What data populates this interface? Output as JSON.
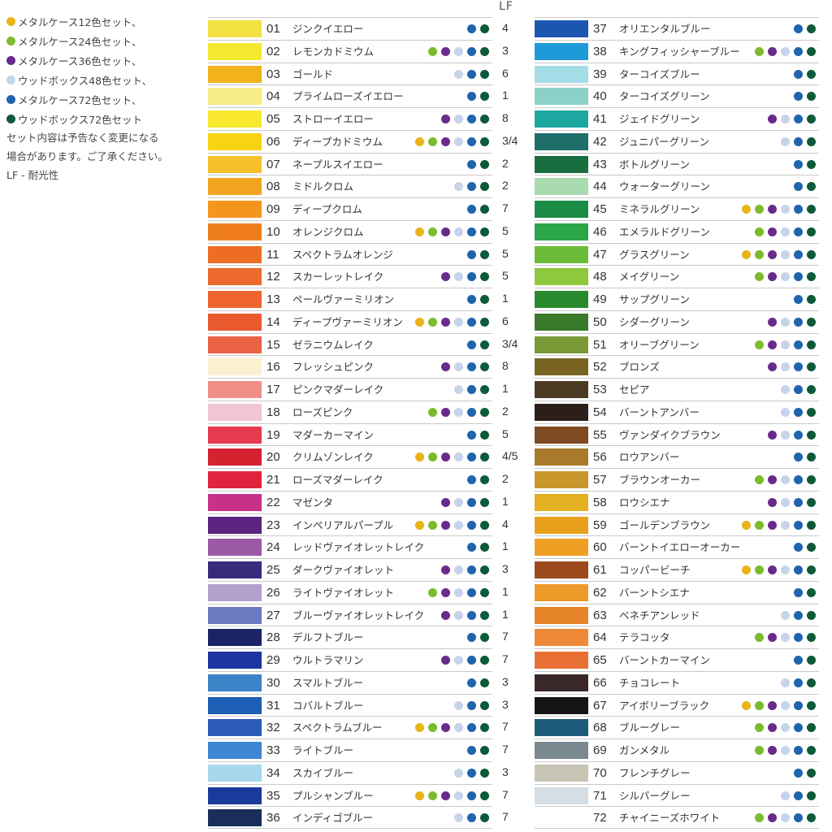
{
  "colors": {
    "s12": "#e8b418",
    "s24": "#7cbb2e",
    "s36": "#6a2a8a",
    "w48": "#c6d4ea",
    "s72": "#1f64ad",
    "w72": "#0d5a3a"
  },
  "legend": {
    "sets": [
      {
        "key": "s12",
        "label": "メタルケース12色セット、"
      },
      {
        "key": "s24",
        "label": "メタルケース24色セット、"
      },
      {
        "key": "s36",
        "label": "メタルケース36色セット、"
      },
      {
        "key": "w48",
        "label": "ウッドボックス48色セット、"
      },
      {
        "key": "s72",
        "label": "メタルケース72色セット、"
      },
      {
        "key": "w72",
        "label": "ウッドボックス72色セット"
      }
    ],
    "note_line1": "セット内容は予告なく変更になる",
    "note_line2": "場合があります。ご了承ください。",
    "lf_note": "LF - 耐光性"
  },
  "lf_header": "LF",
  "columns": [
    [
      {
        "num": "01",
        "name": "ジンクイエロー",
        "lf": "4",
        "sets": [
          "s72",
          "w72"
        ],
        "color": "#f3e142"
      },
      {
        "num": "02",
        "name": "レモンカドミウム",
        "lf": "3",
        "sets": [
          "s24",
          "s36",
          "w48",
          "s72",
          "w72"
        ],
        "color": "#f6e830"
      },
      {
        "num": "03",
        "name": "ゴールド",
        "lf": "6",
        "sets": [
          "w48",
          "s72",
          "w72"
        ],
        "color": "#f2b21c"
      },
      {
        "num": "04",
        "name": "プライムローズイエロー",
        "lf": "1",
        "sets": [
          "s72",
          "w72"
        ],
        "color": "#f7ec86"
      },
      {
        "num": "05",
        "name": "ストローイエロー",
        "lf": "8",
        "sets": [
          "s36",
          "w48",
          "s72",
          "w72"
        ],
        "color": "#f8e82e"
      },
      {
        "num": "06",
        "name": "ディープカドミウム",
        "lf": "3/4",
        "sets": [
          "s12",
          "s24",
          "s36",
          "w48",
          "s72",
          "w72"
        ],
        "color": "#f6d414"
      },
      {
        "num": "07",
        "name": "ネープルスイエロー",
        "lf": "2",
        "sets": [
          "s72",
          "w72"
        ],
        "color": "#f5c02a"
      },
      {
        "num": "08",
        "name": "ミドルクロム",
        "lf": "2",
        "sets": [
          "w48",
          "s72",
          "w72"
        ],
        "color": "#f2a420"
      },
      {
        "num": "09",
        "name": "ディープクロム",
        "lf": "7",
        "sets": [
          "s72",
          "w72"
        ],
        "color": "#f4961c"
      },
      {
        "num": "10",
        "name": "オレンジクロム",
        "lf": "5",
        "sets": [
          "s12",
          "s24",
          "s36",
          "w48",
          "s72",
          "w72"
        ],
        "color": "#ef7f1e"
      },
      {
        "num": "11",
        "name": "スペクトラムオレンジ",
        "lf": "5",
        "sets": [
          "s72",
          "w72"
        ],
        "color": "#ee6d24"
      },
      {
        "num": "12",
        "name": "スカーレットレイク",
        "lf": "5",
        "sets": [
          "s36",
          "w48",
          "s72",
          "w72"
        ],
        "color": "#ec6a2c"
      },
      {
        "num": "13",
        "name": "ペールヴァーミリオン",
        "lf": "1",
        "sets": [
          "s72",
          "w72"
        ],
        "color": "#ee6430"
      },
      {
        "num": "14",
        "name": "ディープヴァーミリオン",
        "lf": "6",
        "sets": [
          "s12",
          "s24",
          "s36",
          "w48",
          "s72",
          "w72"
        ],
        "color": "#e95a2e"
      },
      {
        "num": "15",
        "name": "ゼラニウムレイク",
        "lf": "3/4",
        "sets": [
          "s72",
          "w72"
        ],
        "color": "#ea6244"
      },
      {
        "num": "16",
        "name": "フレッシュピンク",
        "lf": "8",
        "sets": [
          "s36",
          "w48",
          "s72",
          "w72"
        ],
        "color": "#fbf0cf"
      },
      {
        "num": "17",
        "name": "ピンクマダーレイク",
        "lf": "1",
        "sets": [
          "w48",
          "s72",
          "w72"
        ],
        "color": "#ef8f88"
      },
      {
        "num": "18",
        "name": "ローズピンク",
        "lf": "2",
        "sets": [
          "s24",
          "s36",
          "w48",
          "s72",
          "w72"
        ],
        "color": "#f3c4d2"
      },
      {
        "num": "19",
        "name": "マダーカーマイン",
        "lf": "5",
        "sets": [
          "s72",
          "w72"
        ],
        "color": "#e63a4e"
      },
      {
        "num": "20",
        "name": "クリムゾンレイク",
        "lf": "4/5",
        "sets": [
          "s12",
          "s24",
          "s36",
          "w48",
          "s72",
          "w72"
        ],
        "color": "#d42230"
      },
      {
        "num": "21",
        "name": "ローズマダーレイク",
        "lf": "2",
        "sets": [
          "s72",
          "w72"
        ],
        "color": "#e0243e"
      },
      {
        "num": "22",
        "name": "マゼンタ",
        "lf": "1",
        "sets": [
          "s36",
          "w48",
          "s72",
          "w72"
        ],
        "color": "#c8308a"
      },
      {
        "num": "23",
        "name": "インペリアルパープル",
        "lf": "4",
        "sets": [
          "s12",
          "s24",
          "s36",
          "w48",
          "s72",
          "w72"
        ],
        "color": "#5a2480"
      },
      {
        "num": "24",
        "name": "レッドヴァイオレットレイク",
        "lf": "1",
        "sets": [
          "s72",
          "w72"
        ],
        "color": "#9a5ba4"
      },
      {
        "num": "25",
        "name": "ダークヴァイオレット",
        "lf": "3",
        "sets": [
          "s36",
          "w48",
          "s72",
          "w72"
        ],
        "color": "#3a2a7c"
      },
      {
        "num": "26",
        "name": "ライトヴァイオレット",
        "lf": "1",
        "sets": [
          "s24",
          "s36",
          "w48",
          "s72",
          "w72"
        ],
        "color": "#b4a0cc"
      },
      {
        "num": "27",
        "name": "ブルーヴァイオレットレイク",
        "lf": "1",
        "sets": [
          "s36",
          "w48",
          "s72",
          "w72"
        ],
        "color": "#6c78c0"
      },
      {
        "num": "28",
        "name": "デルフトブルー",
        "lf": "7",
        "sets": [
          "s72",
          "w72"
        ],
        "color": "#1c2468"
      },
      {
        "num": "29",
        "name": "ウルトラマリン",
        "lf": "7",
        "sets": [
          "s36",
          "w48",
          "s72",
          "w72"
        ],
        "color": "#1e34a0"
      },
      {
        "num": "30",
        "name": "スマルトブルー",
        "lf": "3",
        "sets": [
          "s72",
          "w72"
        ],
        "color": "#3c84c8"
      },
      {
        "num": "31",
        "name": "コバルトブルー",
        "lf": "3",
        "sets": [
          "w48",
          "s72",
          "w72"
        ],
        "color": "#1e5eb4"
      },
      {
        "num": "32",
        "name": "スペクトラムブルー",
        "lf": "7",
        "sets": [
          "s12",
          "s24",
          "s36",
          "w48",
          "s72",
          "w72"
        ],
        "color": "#2a5cb8"
      },
      {
        "num": "33",
        "name": "ライトブルー",
        "lf": "7",
        "sets": [
          "s72",
          "w72"
        ],
        "color": "#3c86d4"
      },
      {
        "num": "34",
        "name": "スカイブルー",
        "lf": "3",
        "sets": [
          "w48",
          "s72",
          "w72"
        ],
        "color": "#a8d8ec"
      },
      {
        "num": "35",
        "name": "プルシャンブルー",
        "lf": "7",
        "sets": [
          "s12",
          "s24",
          "s36",
          "w48",
          "s72",
          "w72"
        ],
        "color": "#1a3a9c"
      },
      {
        "num": "36",
        "name": "インディゴブルー",
        "lf": "7",
        "sets": [
          "w48",
          "s72",
          "w72"
        ],
        "color": "#1a2e5c"
      }
    ],
    [
      {
        "num": "37",
        "name": "オリエンタルブルー",
        "lf": "",
        "sets": [
          "s72",
          "w72"
        ],
        "color": "#1c56b0"
      },
      {
        "num": "38",
        "name": "キングフィッシャーブルー",
        "lf": "",
        "sets": [
          "s24",
          "s36",
          "w48",
          "s72",
          "w72"
        ],
        "color": "#1e9ad8"
      },
      {
        "num": "39",
        "name": "ターコイズブルー",
        "lf": "",
        "sets": [
          "s72",
          "w72"
        ],
        "color": "#a4dce8"
      },
      {
        "num": "40",
        "name": "ターコイズグリーン",
        "lf": "",
        "sets": [
          "s72",
          "w72"
        ],
        "color": "#8ad2c8"
      },
      {
        "num": "41",
        "name": "ジェイドグリーン",
        "lf": "",
        "sets": [
          "s36",
          "w48",
          "s72",
          "w72"
        ],
        "color": "#1ca8a0"
      },
      {
        "num": "42",
        "name": "ジュニパーグリーン",
        "lf": "",
        "sets": [
          "w48",
          "s72",
          "w72"
        ],
        "color": "#1e6e6a"
      },
      {
        "num": "43",
        "name": "ボトルグリーン",
        "lf": "",
        "sets": [
          "s72",
          "w72"
        ],
        "color": "#186e3e"
      },
      {
        "num": "44",
        "name": "ウォーターグリーン",
        "lf": "",
        "sets": [
          "s72",
          "w72"
        ],
        "color": "#a8dcb0"
      },
      {
        "num": "45",
        "name": "ミネラルグリーン",
        "lf": "",
        "sets": [
          "s12",
          "s24",
          "s36",
          "w48",
          "s72",
          "w72"
        ],
        "color": "#1c8c46"
      },
      {
        "num": "46",
        "name": "エメラルドグリーン",
        "lf": "",
        "sets": [
          "s24",
          "s36",
          "w48",
          "s72",
          "w72"
        ],
        "color": "#2aa648"
      },
      {
        "num": "47",
        "name": "グラスグリーン",
        "lf": "",
        "sets": [
          "s12",
          "s24",
          "s36",
          "w48",
          "s72",
          "w72"
        ],
        "color": "#6cbc3a"
      },
      {
        "num": "48",
        "name": "メイグリーン",
        "lf": "",
        "sets": [
          "s24",
          "s36",
          "w48",
          "s72",
          "w72"
        ],
        "color": "#8ec83c"
      },
      {
        "num": "49",
        "name": "サップグリーン",
        "lf": "",
        "sets": [
          "s72",
          "w72"
        ],
        "color": "#2a8a2e"
      },
      {
        "num": "50",
        "name": "シダーグリーン",
        "lf": "",
        "sets": [
          "s36",
          "w48",
          "s72",
          "w72"
        ],
        "color": "#3a7a2c"
      },
      {
        "num": "51",
        "name": "オリーブグリーン",
        "lf": "",
        "sets": [
          "s24",
          "s36",
          "w48",
          "s72",
          "w72"
        ],
        "color": "#7a9a38"
      },
      {
        "num": "52",
        "name": "ブロンズ",
        "lf": "",
        "sets": [
          "s36",
          "w48",
          "s72",
          "w72"
        ],
        "color": "#7a6424"
      },
      {
        "num": "53",
        "name": "セピア",
        "lf": "",
        "sets": [
          "w48",
          "s72",
          "w72"
        ],
        "color": "#4c3a22"
      },
      {
        "num": "54",
        "name": "バーントアンバー",
        "lf": "",
        "sets": [
          "w48",
          "s72",
          "w72"
        ],
        "color": "#2c1e18"
      },
      {
        "num": "55",
        "name": "ヴァンダイクブラウン",
        "lf": "",
        "sets": [
          "s36",
          "w48",
          "s72",
          "w72"
        ],
        "color": "#7e4a22"
      },
      {
        "num": "56",
        "name": "ロウアンバー",
        "lf": "",
        "sets": [
          "s72",
          "w72"
        ],
        "color": "#a87a2a"
      },
      {
        "num": "57",
        "name": "ブラウンオーカー",
        "lf": "",
        "sets": [
          "s24",
          "s36",
          "w48",
          "s72",
          "w72"
        ],
        "color": "#c8962a"
      },
      {
        "num": "58",
        "name": "ロウシエナ",
        "lf": "",
        "sets": [
          "s36",
          "w48",
          "s72",
          "w72"
        ],
        "color": "#e2b020"
      },
      {
        "num": "59",
        "name": "ゴールデンブラウン",
        "lf": "",
        "sets": [
          "s12",
          "s24",
          "s36",
          "w48",
          "s72",
          "w72"
        ],
        "color": "#e8a01c"
      },
      {
        "num": "60",
        "name": "バーントイエローオーカー",
        "lf": "",
        "sets": [
          "s72",
          "w72"
        ],
        "color": "#eea024"
      },
      {
        "num": "61",
        "name": "コッパービーチ",
        "lf": "",
        "sets": [
          "s12",
          "s24",
          "s36",
          "w48",
          "s72",
          "w72"
        ],
        "color": "#9c4a1e"
      },
      {
        "num": "62",
        "name": "バーントシエナ",
        "lf": "",
        "sets": [
          "s72",
          "w72"
        ],
        "color": "#ee9a2a"
      },
      {
        "num": "63",
        "name": "ベネチアンレッド",
        "lf": "",
        "sets": [
          "w48",
          "s72",
          "w72"
        ],
        "color": "#e6842a"
      },
      {
        "num": "64",
        "name": "テラコッタ",
        "lf": "",
        "sets": [
          "s24",
          "s36",
          "w48",
          "s72",
          "w72"
        ],
        "color": "#ee8a3a"
      },
      {
        "num": "65",
        "name": "バーントカーマイン",
        "lf": "",
        "sets": [
          "s72",
          "w72"
        ],
        "color": "#e87034"
      },
      {
        "num": "66",
        "name": "チョコレート",
        "lf": "",
        "sets": [
          "w48",
          "s72",
          "w72"
        ],
        "color": "#3a2828"
      },
      {
        "num": "67",
        "name": "アイボリーブラック",
        "lf": "",
        "sets": [
          "s12",
          "s24",
          "s36",
          "w48",
          "s72",
          "w72"
        ],
        "color": "#151515"
      },
      {
        "num": "68",
        "name": "ブルーグレー",
        "lf": "",
        "sets": [
          "s24",
          "s36",
          "w48",
          "s72",
          "w72"
        ],
        "color": "#1e5a7a"
      },
      {
        "num": "69",
        "name": "ガンメタル",
        "lf": "",
        "sets": [
          "s24",
          "s36",
          "w48",
          "s72",
          "w72"
        ],
        "color": "#7a8890"
      },
      {
        "num": "70",
        "name": "フレンチグレー",
        "lf": "",
        "sets": [
          "s72",
          "w72"
        ],
        "color": "#c8c4b4"
      },
      {
        "num": "71",
        "name": "シルバーグレー",
        "lf": "",
        "sets": [
          "w48",
          "s72",
          "w72"
        ],
        "color": "#d4dee4"
      },
      {
        "num": "72",
        "name": "チャイニーズホワイト",
        "lf": "",
        "sets": [
          "s24",
          "s36",
          "w48",
          "s72",
          "w72"
        ],
        "color": ""
      }
    ]
  ]
}
